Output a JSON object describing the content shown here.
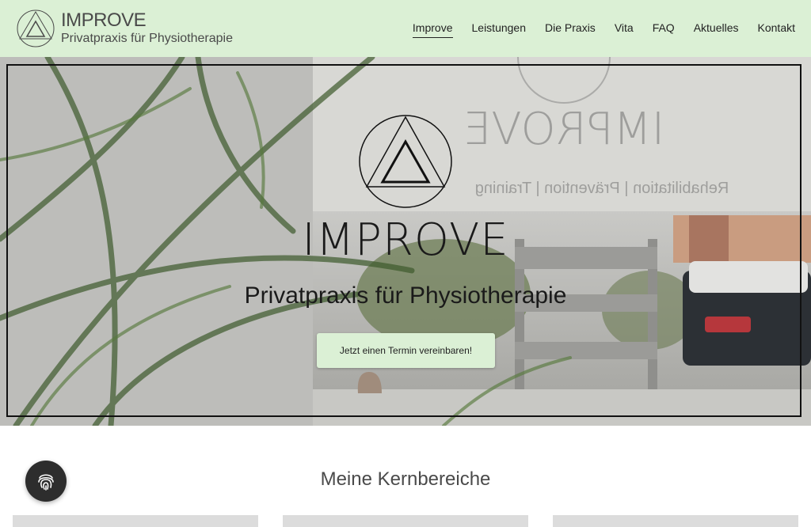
{
  "brand": {
    "name": "IMPROVE",
    "subtitle": "Privatpraxis für Physiotherapie"
  },
  "nav": {
    "items": [
      {
        "label": "Improve",
        "active": true
      },
      {
        "label": "Leistungen",
        "active": false
      },
      {
        "label": "Die Praxis",
        "active": false
      },
      {
        "label": "Vita",
        "active": false
      },
      {
        "label": "FAQ",
        "active": false
      },
      {
        "label": "Aktuelles",
        "active": false
      },
      {
        "label": "Kontakt",
        "active": false
      }
    ]
  },
  "hero": {
    "title": "IMPROVE",
    "subtitle": "Privatpraxis für Physiotherapie",
    "cta_label": "Jetzt einen Termin vereinbaren!",
    "window_text_title": "IMPROVE",
    "window_text_sub": "Rehabilitation | Prävention | Training"
  },
  "section": {
    "title": "Meine Kernbereiche"
  },
  "icons": {
    "logo": "triangle-in-circle-logo",
    "privacy": "fingerprint-icon"
  },
  "colors": {
    "header_bg": "#dbf0d5",
    "cta_bg": "#dbf0d5",
    "privacy_button_bg": "#2d2d2d"
  }
}
